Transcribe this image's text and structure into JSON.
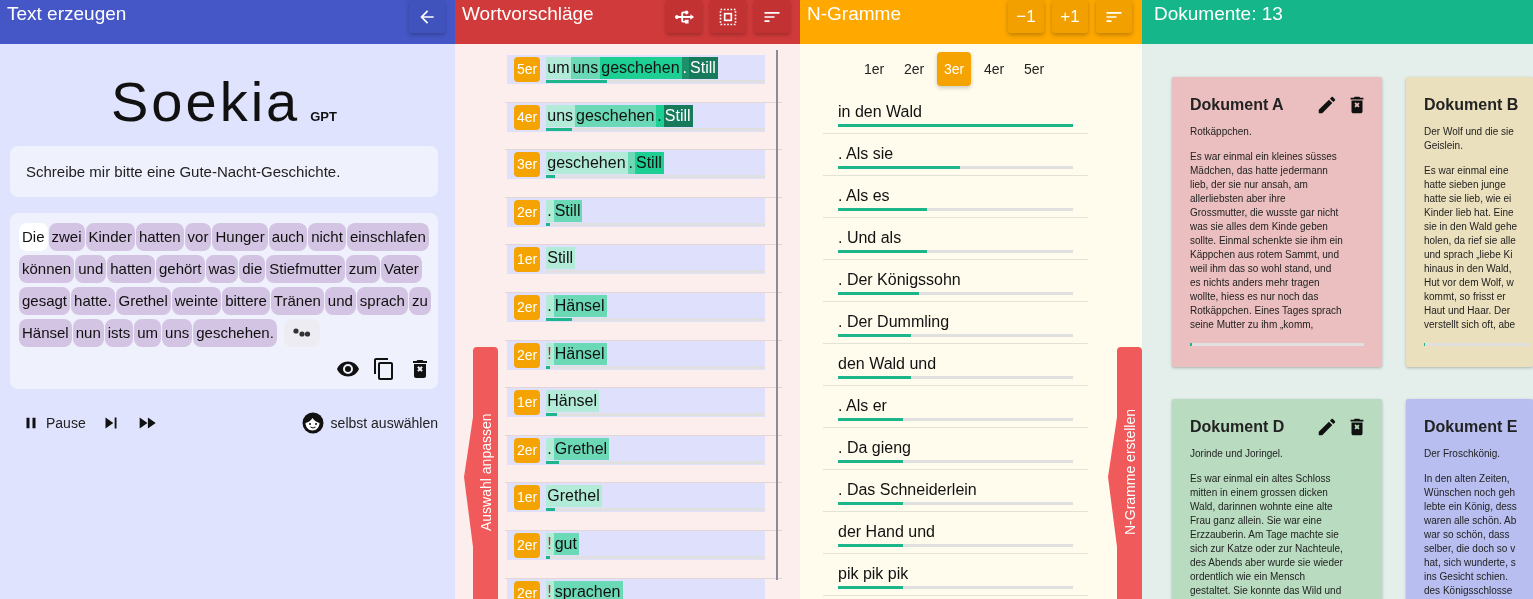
{
  "generator": {
    "title": "Text erzeugen",
    "logo": {
      "name": "Soekia",
      "suffix": "GPT"
    },
    "prompt": "Schreibe mir bitte eine Gute-Nacht-Geschichte.",
    "tokens": [
      {
        "text": "Die",
        "selected": true
      },
      {
        "text": "zwei",
        "selected": false
      },
      {
        "text": "Kinder",
        "selected": false
      },
      {
        "text": "hatten",
        "selected": false
      },
      {
        "text": "vor",
        "selected": false
      },
      {
        "text": "Hunger",
        "selected": false
      },
      {
        "text": "auch",
        "selected": false
      },
      {
        "text": "nicht",
        "selected": false
      },
      {
        "text": "einschlafen",
        "selected": false
      },
      {
        "text": "können",
        "selected": false
      },
      {
        "text": "und",
        "selected": false
      },
      {
        "text": "hatten",
        "selected": false
      },
      {
        "text": "gehört",
        "selected": false
      },
      {
        "text": "was",
        "selected": false
      },
      {
        "text": "die",
        "selected": false
      },
      {
        "text": "Stiefmutter",
        "selected": false
      },
      {
        "text": "zum",
        "selected": false
      },
      {
        "text": "Vater",
        "selected": false
      },
      {
        "text": "gesagt",
        "selected": false
      },
      {
        "text": "hatte.",
        "selected": false
      },
      {
        "text": "Grethel",
        "selected": false
      },
      {
        "text": "weinte",
        "selected": false
      },
      {
        "text": "bittere",
        "selected": false
      },
      {
        "text": "Tränen",
        "selected": false
      },
      {
        "text": "und",
        "selected": false
      },
      {
        "text": "sprach",
        "selected": false
      },
      {
        "text": "zu",
        "selected": false
      },
      {
        "text": "Hänsel",
        "selected": false
      },
      {
        "text": "nun",
        "selected": false
      },
      {
        "text": "ists",
        "selected": false
      },
      {
        "text": "um",
        "selected": false
      },
      {
        "text": "uns",
        "selected": false
      },
      {
        "text": "geschehen.",
        "selected": false
      }
    ],
    "pause_label": "Pause",
    "self_select_label": "selbst auswählen"
  },
  "suggestions": {
    "title": "Wortvorschläge",
    "side_tab": "Auswahl anpassen",
    "rows": [
      {
        "badge": "5er",
        "level": 0.28,
        "segments": [
          {
            "text": "um",
            "color": "#b3ebd9",
            "kind": "word"
          },
          {
            "text": "uns",
            "color": "#6bd9b5",
            "kind": "word"
          },
          {
            "text": "geschehen",
            "color": "#1ecf93",
            "kind": "word"
          },
          {
            "text": ".",
            "color": "#1c8f6b",
            "kind": "word"
          },
          {
            "text": "Still",
            "color": "#177a5b",
            "kind": "word"
          }
        ]
      },
      {
        "badge": "4er",
        "level": 0.12,
        "segments": [
          {
            "text": "uns",
            "color": "#b3ebd9",
            "kind": "word"
          },
          {
            "text": "geschehen",
            "color": "#6bd9b5",
            "kind": "word"
          },
          {
            "text": ".",
            "color": "#1ecf93",
            "kind": "word"
          },
          {
            "text": "Still",
            "color": "#177a5b",
            "kind": "word"
          }
        ]
      },
      {
        "badge": "3er",
        "level": 0.04,
        "segments": [
          {
            "text": "geschehen",
            "color": "#b3ebd9",
            "kind": "word"
          },
          {
            "text": ".",
            "color": "#6bd9b5",
            "kind": "word"
          },
          {
            "text": "Still",
            "color": "#1ecf93",
            "kind": "word"
          }
        ]
      },
      {
        "badge": "2er",
        "level": 0.015,
        "segments": [
          {
            "text": ".",
            "color": "#b3ebd9",
            "kind": "word"
          },
          {
            "text": "Still",
            "color": "#6bd9b5",
            "kind": "word"
          }
        ]
      },
      {
        "badge": "1er",
        "level": 0,
        "segments": [
          {
            "text": "Still",
            "color": "#b3ebd9",
            "kind": "word"
          }
        ]
      },
      {
        "badge": "2er",
        "level": 0.12,
        "segments": [
          {
            "text": ".",
            "color": "#b3ebd9",
            "kind": "word"
          },
          {
            "text": "Hänsel",
            "color": "#6bd9b5",
            "kind": "word"
          }
        ]
      },
      {
        "badge": "2er",
        "level": 0.015,
        "segments": [
          {
            "text": "!",
            "color": "#b3ebd9",
            "kind": "alert"
          },
          {
            "text": "Hänsel",
            "color": "#6bd9b5",
            "kind": "word"
          }
        ]
      },
      {
        "badge": "1er",
        "level": 0.05,
        "segments": [
          {
            "text": "Hänsel",
            "color": "#b3ebd9",
            "kind": "word"
          }
        ]
      },
      {
        "badge": "2er",
        "level": 0.06,
        "segments": [
          {
            "text": ".",
            "color": "#b3ebd9",
            "kind": "word"
          },
          {
            "text": "Grethel",
            "color": "#6bd9b5",
            "kind": "word"
          }
        ]
      },
      {
        "badge": "1er",
        "level": 0.04,
        "segments": [
          {
            "text": "Grethel",
            "color": "#b3ebd9",
            "kind": "word"
          }
        ]
      },
      {
        "badge": "2er",
        "level": 0.015,
        "segments": [
          {
            "text": "!",
            "color": "#b3ebd9",
            "kind": "alert"
          },
          {
            "text": "gut",
            "color": "#6bd9b5",
            "kind": "word"
          }
        ]
      },
      {
        "badge": "2er",
        "segments": [
          {
            "text": "!",
            "color": "#b3ebd9",
            "kind": "alert"
          },
          {
            "text": "sprachen",
            "color": "#6bd9b5",
            "kind": "word"
          }
        ]
      }
    ]
  },
  "ngrams": {
    "title": "N-Gramme",
    "buttons": [
      "−1",
      "+1"
    ],
    "side_tab": "N-Gramme erstellen",
    "tabs": [
      {
        "label": "1er",
        "selected": false
      },
      {
        "label": "2er",
        "selected": false
      },
      {
        "label": "3er",
        "selected": true
      },
      {
        "label": "4er",
        "selected": false
      },
      {
        "label": "5er",
        "selected": false
      }
    ],
    "rows": [
      {
        "text": "in den Wald",
        "level": 1
      },
      {
        "text": ". Als sie",
        "level": 0.52
      },
      {
        "text": ". Als es",
        "level": 0.38
      },
      {
        "text": ". Und als",
        "level": 0.38
      },
      {
        "text": ". Der Königssohn",
        "level": 0.345
      },
      {
        "text": ". Der Dummling",
        "level": 0.31
      },
      {
        "text": "den Wald und",
        "level": 0.31
      },
      {
        "text": ". Als er",
        "level": 0.275
      },
      {
        "text": ". Da gieng",
        "level": 0.275
      },
      {
        "text": ". Das Schneiderlein",
        "level": 0.275
      },
      {
        "text": "der Hand und",
        "level": 0.275
      },
      {
        "text": "pik pik pik",
        "level": 0.275
      }
    ]
  },
  "documents": {
    "title": "Dokumente: 13",
    "cards": [
      {
        "title": "Dokument A",
        "color": "#ebbfbf",
        "cut_off": false,
        "level": 0.01,
        "paragraphs": [
          [
            "Rotkäppchen."
          ],
          [
            "Es war einmal ein kleines süsses",
            "Mädchen, das hatte jedermann",
            "lieb, der sie nur ansah, am",
            "allerliebsten aber ihre",
            "Grossmutter, die wusste gar nicht",
            "was sie alles dem Kinde geben",
            "sollte. Einmal schenkte sie ihm ein",
            "Käppchen aus rotem Sammt, und",
            "weil ihm das so wohl stand, und",
            "es nichts anders mehr tragen",
            "wollte, hiess es nur noch das",
            "Rotkäppchen. Eines Tages sprach",
            "seine Mutter zu ihm „komm,"
          ]
        ]
      },
      {
        "title": "Dokument B",
        "color": "#ebe0bd",
        "cut_off": true,
        "level": 0.01,
        "paragraphs": [
          [
            "Der Wolf und die sie",
            "Geislein."
          ],
          [
            "Es war einmal eine",
            "hatte sieben junge",
            "hatte sie lieb, wie ei",
            "Kinder lieb hat. Eine",
            "sie in den Wald gehe",
            "holen, da rief sie alle",
            "und sprach „liebe Ki",
            "hinaus in den Wald,",
            "Hut vor dem Wolf, w",
            "kommt, so frisst er",
            "Haut und Haar. Der",
            "verstellt sich oft, abe"
          ]
        ]
      },
      {
        "title": "Dokument D",
        "color": "#b9dcc0",
        "cut_off": false,
        "paragraphs": [
          [
            "Jorinde und Joringel."
          ],
          [
            "Es war einmal ein altes Schloss",
            "mitten in einem grossen dicken",
            "Wald, darinnen wohnte eine alte",
            "Frau ganz allein. Sie war eine",
            "Erzzauberin. Am Tage machte sie",
            "sich zur Katze oder zur Nachteule,",
            "des Abends aber wurde sie wieder",
            "ordentlich wie ein Mensch",
            "gestaltet. Sie konnte das Wild und"
          ]
        ]
      },
      {
        "title": "Dokument E",
        "color": "#b8bef0",
        "cut_off": true,
        "paragraphs": [
          [
            "Der Froschkönig."
          ],
          [
            "In den alten Zeiten,",
            "Wünschen noch geh",
            "lebte ein König, dess",
            "waren alle schön. Ab",
            "war so schön, dass",
            "selber, die doch so v",
            "hat, sich wunderte, s",
            "ins Gesicht schien.",
            "des Königsschlosse"
          ]
        ]
      }
    ]
  }
}
